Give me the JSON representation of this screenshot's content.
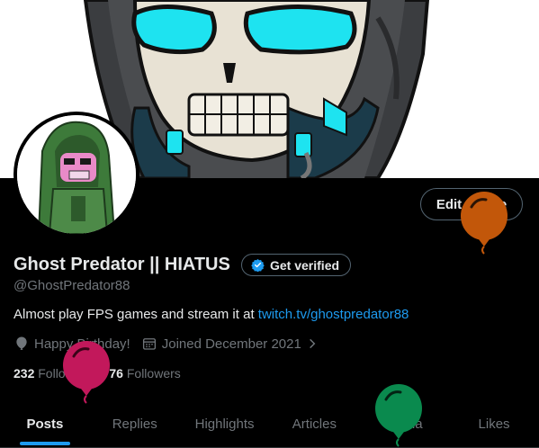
{
  "profile": {
    "display_name": "Ghost Predator || HIATUS",
    "handle": "@GhostPredator88",
    "bio_text": "Almost play FPS games and stream it at ",
    "bio_link": "twitch.tv/ghostpredator88",
    "birthday": "Happy Birthday!",
    "joined": "Joined December 2021",
    "following_count": "232",
    "following_label": "Following",
    "followers_count": "76",
    "followers_label": "Followers"
  },
  "buttons": {
    "edit_profile": "Edit profile",
    "get_verified": "Get verified"
  },
  "tabs": [
    {
      "label": "Posts",
      "active": true
    },
    {
      "label": "Replies",
      "active": false
    },
    {
      "label": "Highlights",
      "active": false
    },
    {
      "label": "Articles",
      "active": false
    },
    {
      "label": "Media",
      "active": false
    },
    {
      "label": "Likes",
      "active": false
    }
  ],
  "colors": {
    "accent": "#1d9bf0",
    "background": "#000000",
    "balloon_orange": "#c2570a",
    "balloon_pink": "#c2185b",
    "balloon_green": "#0a8a4e"
  },
  "icons": [
    "balloon-icon",
    "calendar-icon",
    "chevron-right-icon",
    "verified-badge-icon"
  ]
}
